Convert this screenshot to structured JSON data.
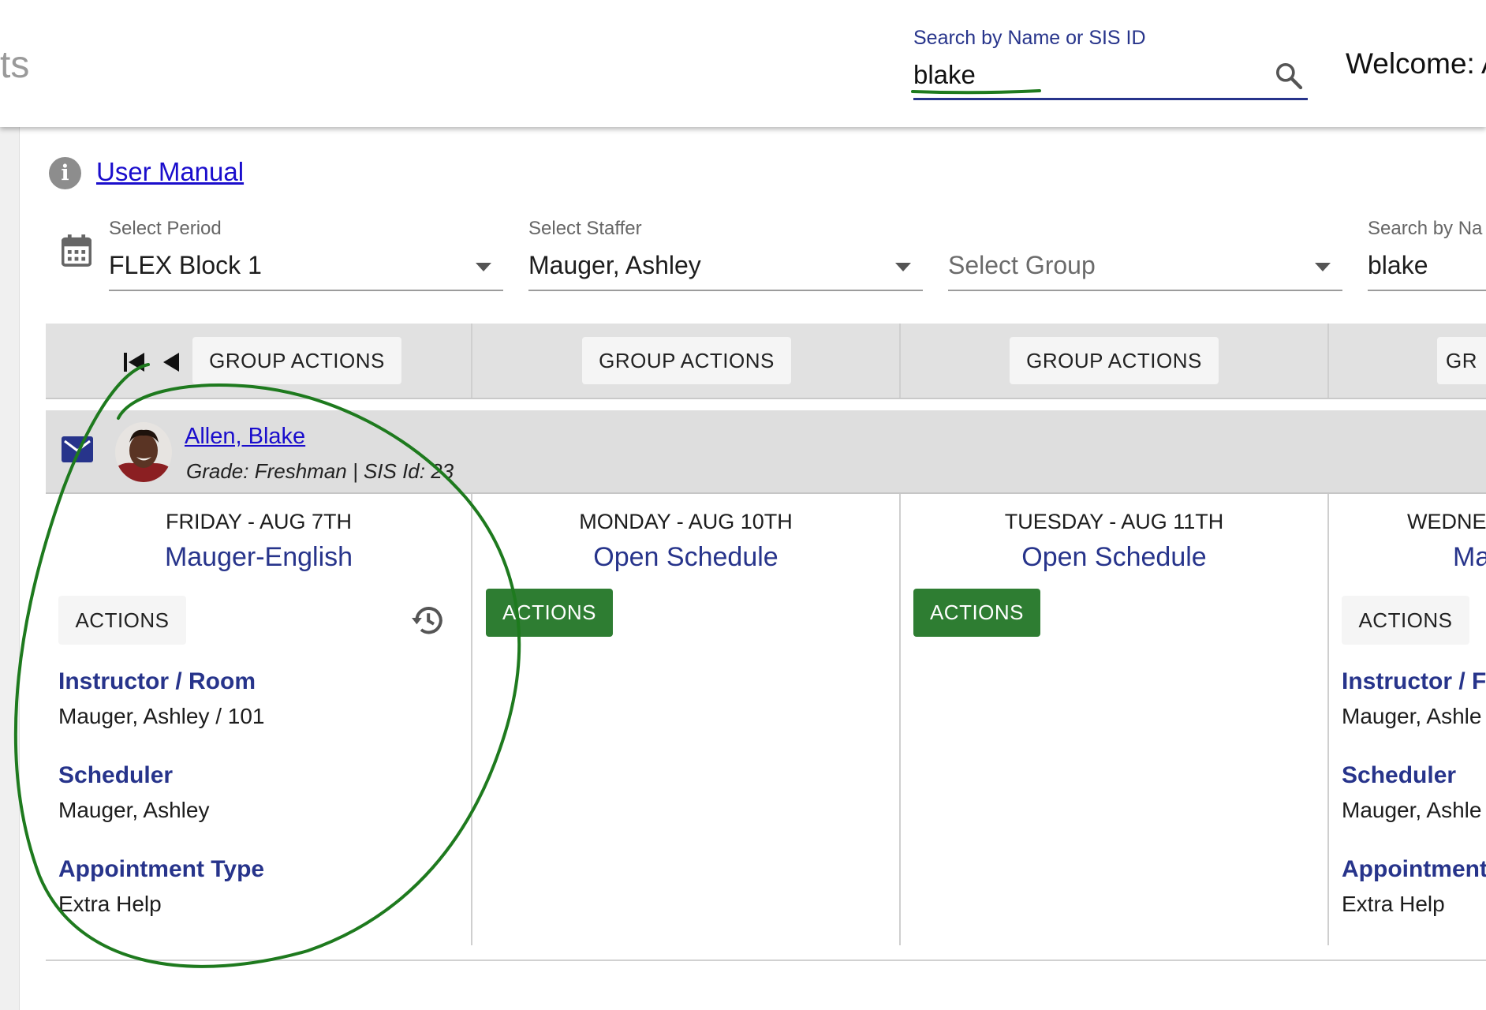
{
  "header": {
    "app_title_fragment": "ts",
    "search_label": "Search by Name or SIS ID",
    "search_value": "blake",
    "welcome_text": "Welcome: A"
  },
  "help": {
    "manual_link": "User Manual"
  },
  "filters": {
    "period": {
      "label": "Select Period",
      "value": "FLEX Block 1"
    },
    "staffer": {
      "label": "Select Staffer",
      "value": "Mauger, Ashley"
    },
    "group": {
      "placeholder": "Select Group"
    },
    "name_search": {
      "label": "Search by Na",
      "value": "blake"
    }
  },
  "group_actions": {
    "label": "GROUP ACTIONS",
    "cut_label": "GR"
  },
  "student": {
    "name": "Allen, Blake",
    "meta": "Grade: Freshman  |  SIS Id: 23"
  },
  "labels": {
    "actions": "ACTIONS",
    "instructor_room": "Instructor / Room",
    "instructor_room_cut": "Instructor / F",
    "scheduler": "Scheduler",
    "appointment_type": "Appointment Type",
    "appointment_cut": "Appointment"
  },
  "days": [
    {
      "date": "FRIDAY - AUG 7TH",
      "schedule": "Mauger-English",
      "instructor_room": "Mauger, Ashley / 101",
      "scheduler": "Mauger, Ashley",
      "appointment_type": "Extra Help"
    },
    {
      "date": "MONDAY - AUG 10TH",
      "schedule": "Open Schedule"
    },
    {
      "date": "TUESDAY - AUG 11TH",
      "schedule": "Open Schedule"
    },
    {
      "date": "WEDNE",
      "schedule": "Ma",
      "instructor_room": "Mauger, Ashle",
      "scheduler": "Mauger, Ashle",
      "appointment_type": "Extra Help"
    }
  ],
  "colors": {
    "brand_blue": "#27348b",
    "link_blue": "#1a0dcc",
    "action_green": "#2e7d32",
    "annotation_green": "#1e7a1e"
  },
  "icons": [
    "search-icon",
    "info-icon",
    "calendar-icon",
    "chevron-down-icon",
    "first-page-icon",
    "previous-icon",
    "mail-icon",
    "history-icon"
  ]
}
